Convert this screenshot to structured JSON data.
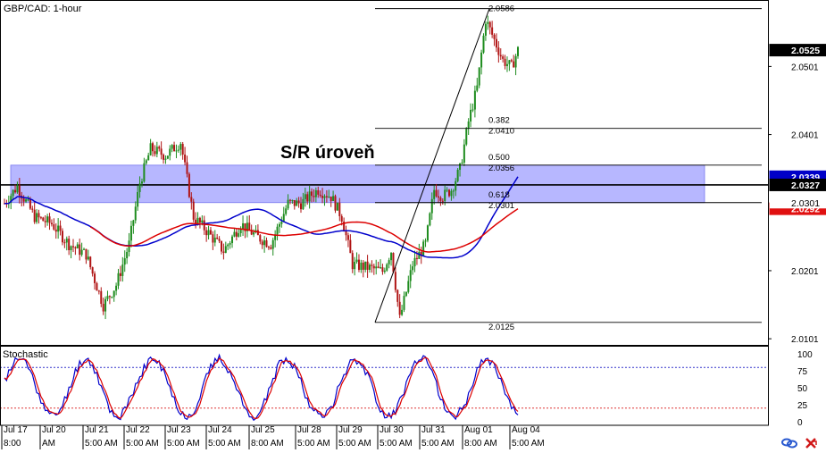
{
  "chart_data": [
    {
      "type": "candlestick",
      "title": "GBP/CAD: 1-hour",
      "annotation": "S/R úroveň",
      "ylim": [
        2.0092,
        2.0596
      ],
      "price_ticks": [
        "2.0101",
        "2.0201",
        "2.0401",
        "2.0501"
      ],
      "current_price_labels": [
        {
          "value": "2.0525",
          "color": "#000000",
          "text_color": "#ffffff"
        },
        {
          "value": "2.0339",
          "color": "#0000c8",
          "text_color": "#ffffff"
        },
        {
          "value": "2.0327",
          "color": "#000000",
          "text_color": "#ffffff"
        },
        {
          "value": "2.0292",
          "color": "#e01010",
          "text_color": "#ffffff"
        },
        {
          "value": "2.0301",
          "color": "#ffffff",
          "text_color": "#000000"
        }
      ],
      "support_resistance_zone": {
        "low": 2.0301,
        "high": 2.0356,
        "color": "#9999ff"
      },
      "sr_line": 2.0327,
      "fibonacci": {
        "swing_low": 2.0125,
        "swing_high": 2.0586,
        "levels": [
          {
            "ratio": "",
            "price": "2.0586",
            "value": 2.0586
          },
          {
            "ratio": "0.382",
            "price": "2.0410",
            "value": 2.041
          },
          {
            "ratio": "0.500",
            "price": "2.0356",
            "value": 2.0356
          },
          {
            "ratio": "0.618",
            "price": "2.0301",
            "value": 2.0301
          },
          {
            "ratio": "",
            "price": "2.0125",
            "value": 2.0125
          }
        ]
      },
      "moving_averages": [
        {
          "color": "#0000cc",
          "last": 2.0339
        },
        {
          "color": "#dd0000",
          "last": 2.0292
        }
      ],
      "candle_colors": {
        "up": "#1e8c1e",
        "down": "#b01414"
      }
    },
    {
      "type": "line",
      "title": "Stochastic",
      "ylim": [
        0,
        100
      ],
      "y_ticks": [
        "100",
        "75",
        "50",
        "25",
        "0"
      ],
      "levels": [
        80,
        20
      ],
      "series_colors": [
        "#0000cc",
        "#dd0000"
      ]
    }
  ],
  "x_axis": {
    "date_labels": [
      "Jul 17",
      "Jul 20",
      "Jul 21",
      "Jul 22",
      "Jul 23",
      "Jul 24",
      "Jul 25",
      "Jul 28",
      "Jul 29",
      "Jul 30",
      "Jul 31",
      "Aug 01",
      "Aug 04"
    ],
    "time_labels": [
      "8:00",
      "AM",
      "5:00 AM",
      "5:00 AM",
      "5:00 AM",
      "5:00 AM",
      "8:00 AM",
      "5:00 AM",
      "5:00 AM",
      "5:00 AM",
      "5:00 AM",
      "8:00 AM",
      "5:00 AM"
    ]
  },
  "icons": [
    "chain-link-icon",
    "close-red-icon"
  ]
}
